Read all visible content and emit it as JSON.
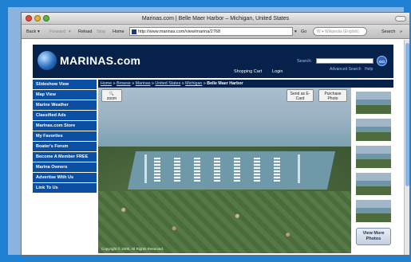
{
  "window": {
    "title": "Marinas.com | Belle Maer Harbor – Michigan, United States"
  },
  "toolbar": {
    "back": "Back",
    "forward": "Forward",
    "reload": "Reload",
    "stop": "Stop",
    "home": "Home",
    "url": "http://www.marinas.com/view/marina/2768",
    "go": "Go",
    "search_placeholder": "W ▾ Wikipedia (English)",
    "search_label": "Search"
  },
  "site": {
    "logo": "MARINAS.com",
    "shopping_cart": "Shopping Cart",
    "login": "Login",
    "search_label": "Search:",
    "go": "GO",
    "advanced_search": "Advanced Search",
    "help": "Help"
  },
  "sidebar": {
    "items": [
      {
        "label": "Slideshow View"
      },
      {
        "label": "Map View"
      },
      {
        "label": "Marine Weather"
      },
      {
        "label": "Classified Ads"
      },
      {
        "label": "Marinas.com Store"
      },
      {
        "label": "My Favorites"
      },
      {
        "label": "Boater's Forum"
      },
      {
        "label": "Become A Member FREE"
      },
      {
        "label": "Marina Owners"
      },
      {
        "label": "Advertise With Us"
      },
      {
        "label": "Link To Us"
      }
    ]
  },
  "breadcrumb": {
    "home": "Home",
    "browse": "Browse",
    "marinas": "Marinas",
    "country": "United States",
    "state": "Michigan",
    "current": "Belle Maer Harbor",
    "sep": "»"
  },
  "photo": {
    "zoom_label": "zoom",
    "send_ecard": "Send as E-Card",
    "purchase_photo": "Purchase Photo",
    "copyright": "Copyright © 2008. All Rights Reserved.",
    "view_more": "View More Photos"
  }
}
